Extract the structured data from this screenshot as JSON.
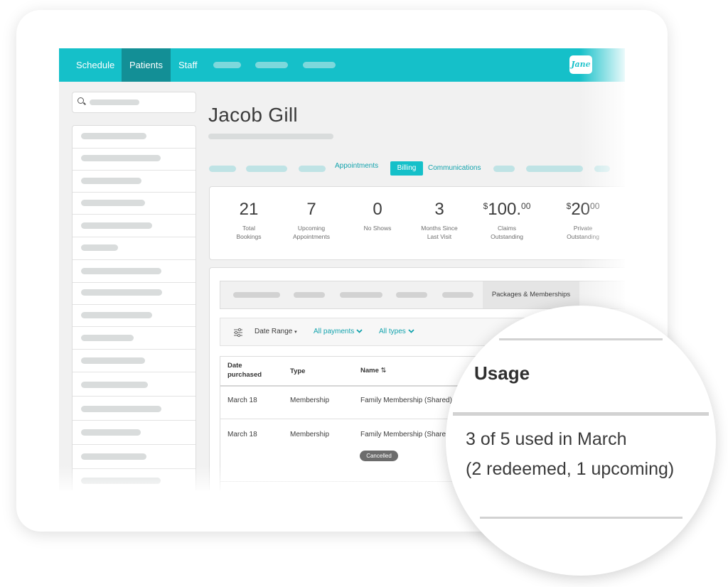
{
  "nav": {
    "tabs": [
      "Schedule",
      "Patients",
      "Staff"
    ],
    "logo_text": "Jane"
  },
  "patient": {
    "name": "Jacob Gill"
  },
  "profile_tabs": {
    "appointments": "Appointments",
    "billing": "Billing",
    "communications": "Communications"
  },
  "stats": [
    {
      "value": "21",
      "label_line1": "Total",
      "label_line2": "Bookings"
    },
    {
      "value": "7",
      "label_line1": "Upcoming",
      "label_line2": "Appointments"
    },
    {
      "value": "0",
      "label_line1": "No Shows",
      "label_line2": ""
    },
    {
      "value": "3",
      "label_line1": "Months Since",
      "label_line2": "Last Visit"
    },
    {
      "currency": "$",
      "value": "100.",
      "cents": "00",
      "label_line1": "Claims",
      "label_line2": "Outstanding"
    },
    {
      "currency": "$",
      "value": "20",
      "cents": "00",
      "label_line1": "Private",
      "label_line2": "Outstanding"
    }
  ],
  "subtabs": {
    "active": "Packages & Memberships"
  },
  "filters": {
    "date_range": "Date Range",
    "payments": "All payments",
    "types": "All types"
  },
  "table": {
    "headers": {
      "date_line1": "Date",
      "date_line2": "purchased",
      "type": "Type",
      "name": "Name"
    },
    "rows": [
      {
        "date": "March 18",
        "type": "Membership",
        "name": "Family Membership (Shared)"
      },
      {
        "date": "March 18",
        "type": "Membership",
        "name": "Family Membership (Share",
        "status": "Cancelled"
      }
    ]
  },
  "zoom": {
    "title": "Usage",
    "line1": "3 of 5 used in March",
    "line2": "(2 redeemed, 1 upcoming)"
  },
  "colors": {
    "accent": "#15c0c9",
    "accent_dark": "#138f96",
    "link": "#13a3ad"
  }
}
